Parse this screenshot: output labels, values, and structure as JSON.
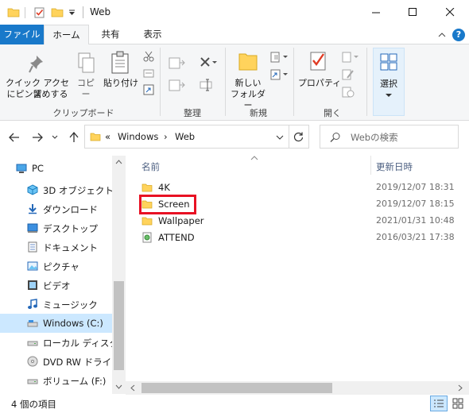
{
  "window": {
    "title": "Web"
  },
  "ribbon": {
    "tabs": {
      "file": "ファイル",
      "home": "ホーム",
      "share": "共有",
      "view": "表示"
    },
    "buttons": {
      "pin_line1": "クイック アクセス",
      "pin_line2": "にピン留めする",
      "copy": "コピー",
      "paste": "貼り付け",
      "new_folder_line1": "新しい",
      "new_folder_line2": "フォルダー",
      "properties": "プロパティ",
      "select": "選択"
    },
    "groups": {
      "clipboard": "クリップボード",
      "organize": "整理",
      "new": "新規",
      "open": "開く"
    }
  },
  "address": {
    "overflow": "«",
    "segments": [
      "Windows",
      "Web"
    ],
    "separator": "›"
  },
  "search": {
    "placeholder": "Webの検索"
  },
  "nav_pane": {
    "items": [
      {
        "label": "PC",
        "icon": "pc-icon"
      },
      {
        "label": "3D オブジェクト",
        "icon": "3d-objects-icon"
      },
      {
        "label": "ダウンロード",
        "icon": "download-icon"
      },
      {
        "label": "デスクトップ",
        "icon": "desktop-icon"
      },
      {
        "label": "ドキュメント",
        "icon": "documents-icon"
      },
      {
        "label": "ピクチャ",
        "icon": "pictures-icon"
      },
      {
        "label": "ビデオ",
        "icon": "video-icon"
      },
      {
        "label": "ミュージック",
        "icon": "music-icon"
      },
      {
        "label": "Windows (C:)",
        "icon": "drive-c-icon"
      },
      {
        "label": "ローカル ディスク (D",
        "icon": "drive-d-icon"
      },
      {
        "label": "DVD RW ドライブ (",
        "icon": "dvd-drive-icon"
      },
      {
        "label": "ボリューム (F:)",
        "icon": "drive-f-icon"
      }
    ],
    "selected_index": 8
  },
  "file_list": {
    "columns": {
      "name": "名前",
      "modified": "更新日時"
    },
    "rows": [
      {
        "name": "4K",
        "modified": "2019/12/07 18:31",
        "type": "folder"
      },
      {
        "name": "Screen",
        "modified": "2019/12/07 18:15",
        "type": "folder"
      },
      {
        "name": "Wallpaper",
        "modified": "2021/01/31 10:48",
        "type": "folder"
      },
      {
        "name": "ATTEND",
        "modified": "2016/03/21 17:38",
        "type": "file"
      }
    ],
    "highlighted_index": 1
  },
  "status_bar": {
    "item_count": "4 個の項目"
  },
  "colors": {
    "file_tab": "#1979ca",
    "highlight": "#e81123",
    "folder": "#ffd35c",
    "selected_nav": "#cce8ff"
  }
}
